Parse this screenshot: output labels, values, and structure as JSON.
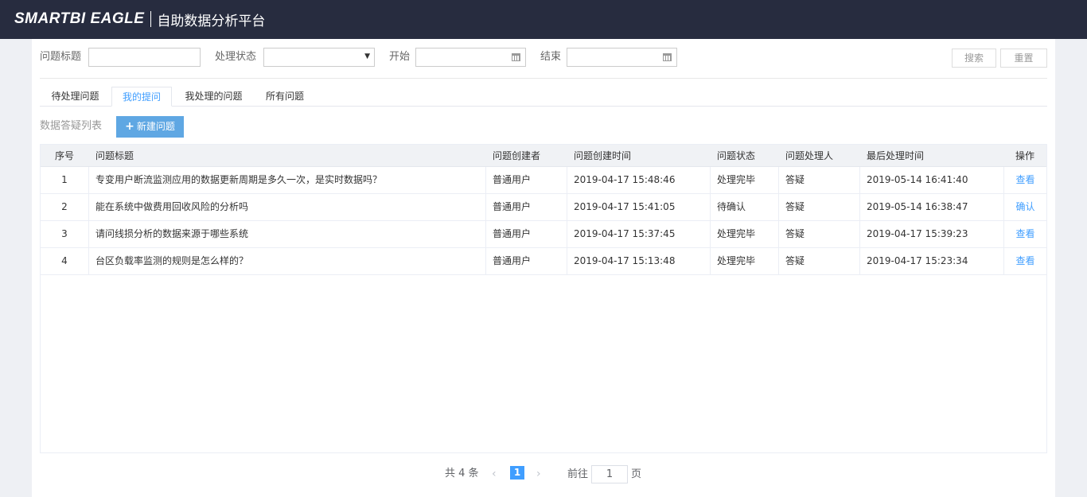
{
  "header": {
    "brand": "SMARTBI EAGLE",
    "subtitle": "自助数据分析平台"
  },
  "filters": {
    "title_label": "问题标题",
    "title_value": "",
    "status_label": "处理状态",
    "status_value": "",
    "start_label": "开始",
    "start_value": "",
    "end_label": "结束",
    "end_value": "",
    "search_label": "搜索",
    "reset_label": "重置"
  },
  "tabs": [
    {
      "label": "待处理问题",
      "active": false
    },
    {
      "label": "我的提问",
      "active": true
    },
    {
      "label": "我处理的问题",
      "active": false
    },
    {
      "label": "所有问题",
      "active": false
    }
  ],
  "list": {
    "title": "数据答疑列表",
    "new_button": "新建问题"
  },
  "table": {
    "columns": [
      "序号",
      "问题标题",
      "问题创建者",
      "问题创建时间",
      "问题状态",
      "问题处理人",
      "最后处理时间",
      "操作"
    ],
    "rows": [
      {
        "index": "1",
        "title": "专变用户断流监测应用的数据更新周期是多久一次，是实时数据吗？",
        "creator": "普通用户",
        "created": "2019-04-17 15:48:46",
        "status": "处理完毕",
        "handler": "答疑",
        "updated": "2019-05-14 16:41:40",
        "action": "查看"
      },
      {
        "index": "2",
        "title": "能在系统中做费用回收风险的分析吗",
        "creator": "普通用户",
        "created": "2019-04-17 15:41:05",
        "status": "待确认",
        "handler": "答疑",
        "updated": "2019-05-14 16:38:47",
        "action": "确认"
      },
      {
        "index": "3",
        "title": "请问线损分析的数据来源于哪些系统",
        "creator": "普通用户",
        "created": "2019-04-17 15:37:45",
        "status": "处理完毕",
        "handler": "答疑",
        "updated": "2019-04-17 15:39:23",
        "action": "查看"
      },
      {
        "index": "4",
        "title": "台区负载率监测的规则是怎么样的？",
        "creator": "普通用户",
        "created": "2019-04-17 15:13:48",
        "status": "处理完毕",
        "handler": "答疑",
        "updated": "2019-04-17 15:23:34",
        "action": "查看"
      }
    ]
  },
  "pagination": {
    "total": "共 4 条",
    "current_page": "1",
    "goto_label": "前往",
    "goto_value": "1",
    "goto_unit": "页"
  },
  "colors": {
    "topbar": "#272c3f",
    "accent": "#409eff",
    "new_button": "#5fa7e3"
  }
}
